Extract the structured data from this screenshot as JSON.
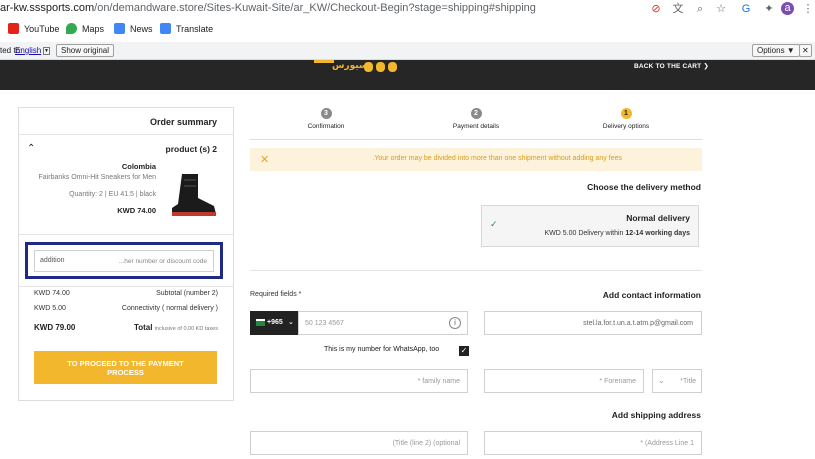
{
  "browser": {
    "url_prefix": "ar-kw.sssports.com",
    "url_rest": "/on/demandware.store/Sites-Kuwait-Site/ar_KW/Checkout-Begin?stage=shipping#shipping",
    "avatar_letter": "a",
    "bookmarks": [
      {
        "label": "YouTube",
        "icon": "youtube-icon",
        "color": "#e62117"
      },
      {
        "label": "Maps",
        "icon": "maps-icon",
        "color": "#34a853"
      },
      {
        "label": "News",
        "icon": "news-icon",
        "color": "#4285f4"
      },
      {
        "label": "Translate",
        "icon": "translate-icon",
        "color": "#4285f4"
      }
    ]
  },
  "translate_bar": {
    "prefix": "ted to:",
    "language": "English",
    "show_original": "Show original",
    "options": "Options ▼",
    "close": "✕"
  },
  "site_header": {
    "logo_text": "ﺳﻴﻮﺭﺱ",
    "back_to_cart": "BACK TO THE CART ❯"
  },
  "order_summary": {
    "title": "Order summary",
    "products_count": "product (s) 2",
    "item": {
      "brand": "Colombia",
      "name": "Fairbanks Omni-Hit Sneakers for Men",
      "quantity_size_color": "Quantity: 2 | EU 41.5 | black",
      "price": "KWD 74.00"
    },
    "code_label": "addition",
    "code_placeholder": "...her number or discount code",
    "subtotal_value": "KWD 74.00",
    "subtotal_label": "Subtotal (number 2)",
    "shipping_value": "KWD 5.00",
    "shipping_label": "Connectivity ( normal delivery )",
    "total_value": "KWD 79.00",
    "total_label": "Total",
    "total_note": "inclusive of 0.00 KD taxes",
    "proceed_label_1": "TO PROCEED TO THE PAYMENT",
    "proceed_label_2": "PROCESS"
  },
  "steps": [
    {
      "number": "3",
      "label": "Confirmation"
    },
    {
      "number": "2",
      "label": "Payment details"
    },
    {
      "number": "1",
      "label": "Delivery options"
    }
  ],
  "notice": ".Your order may be divided into more than one shipment without adding any fees",
  "delivery": {
    "heading": "Choose the delivery method",
    "option_title": "Normal delivery",
    "option_desc_prefix": "KWD 5.00 Delivery within ",
    "option_desc_bold": "12-14 working days"
  },
  "contact": {
    "required_note": "Required fields *",
    "heading": "Add contact information",
    "phone_cc": "+965",
    "phone_placeholder": "50 123 4567",
    "email_value": "stel.la.for.t.un.a.t.atm.p@gmail.com",
    "whatsapp_label": "This is my number for WhatsApp, too",
    "family_name": "* family name",
    "forename": "* Forename",
    "title": "*Title"
  },
  "shipping": {
    "heading": "Add shipping address",
    "address2": "(Title (line 2) (optional",
    "address1": "* (Address Line 1"
  },
  "colors": {
    "accent": "#f2b72c",
    "header_bg": "#262626",
    "highlight_border": "#1f2a86"
  }
}
